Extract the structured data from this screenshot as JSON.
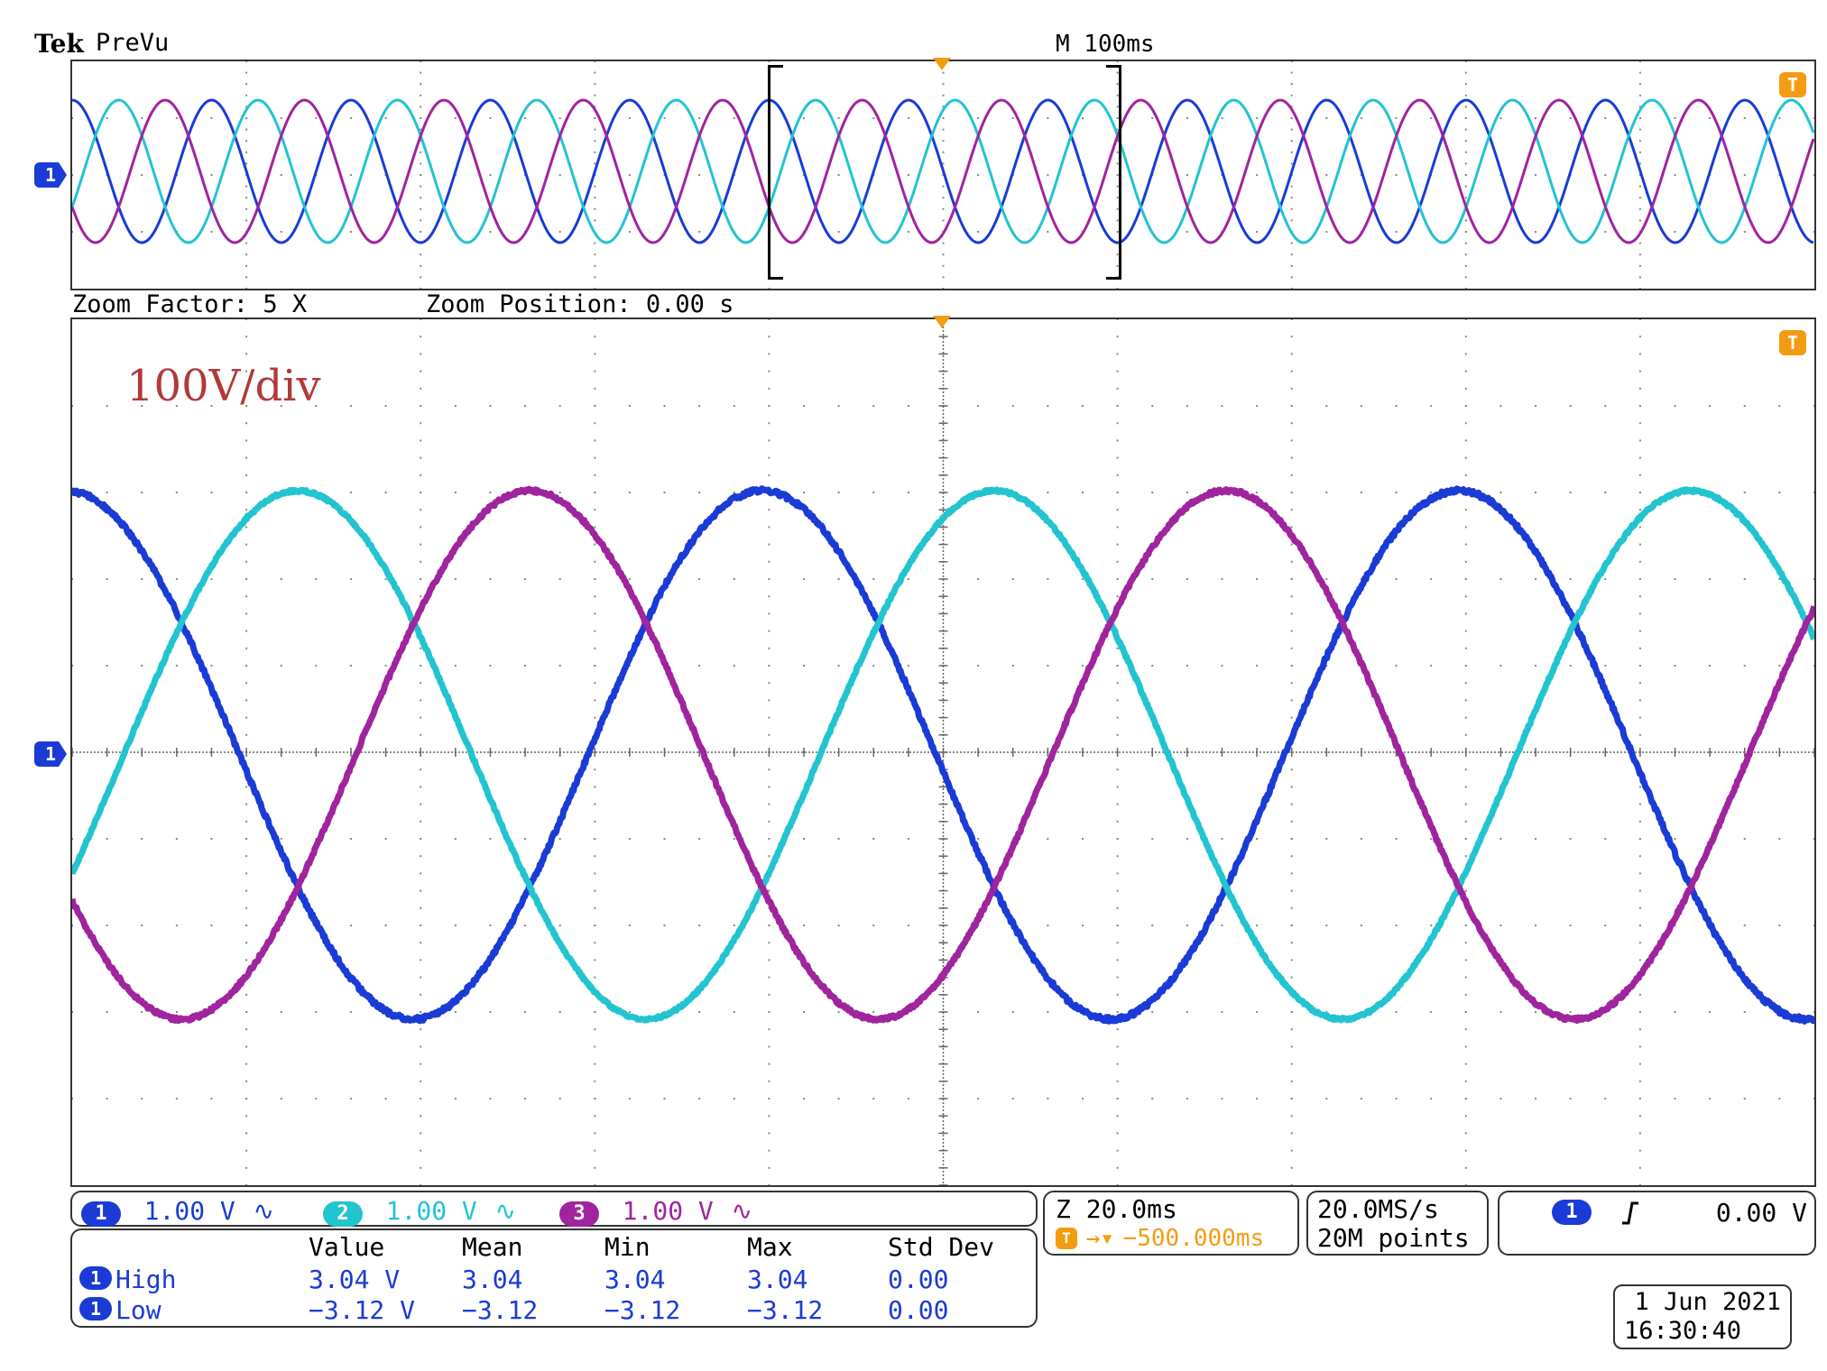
{
  "header": {
    "brand": "Tek",
    "mode": "PreVu",
    "main_timebase": "M 100ms"
  },
  "zoom": {
    "factor_label": "Zoom Factor: 5 X",
    "position_label": "Zoom Position: 0.00 s"
  },
  "annotation": "100V/div",
  "markers": {
    "ch1_ground": "1",
    "trigger_flag": "T"
  },
  "channels": [
    {
      "num": "1",
      "scale": "1.00 V",
      "coupling_icon": "∿",
      "color": "#1a3bd6"
    },
    {
      "num": "2",
      "scale": "1.00 V",
      "coupling_icon": "∿",
      "color": "#22c4d0"
    },
    {
      "num": "3",
      "scale": "1.00 V",
      "coupling_icon": "∿",
      "color": "#a0249e"
    }
  ],
  "timebase": {
    "zoom": "Z 20.0ms",
    "trigger_offset": "−500.000ms",
    "sample_rate": "20.0MS/s",
    "record_length": "20M points"
  },
  "trigger": {
    "source": "1",
    "slope_icon": "rising-edge",
    "level": "0.00 V"
  },
  "measurements": {
    "headers": [
      "Value",
      "Mean",
      "Min",
      "Max",
      "Std Dev"
    ],
    "rows": [
      {
        "source": "1",
        "label": "High",
        "value": "3.04 V",
        "mean": "3.04",
        "min": "3.04",
        "max": "3.04",
        "std": "0.00"
      },
      {
        "source": "1",
        "label": "Low",
        "value": "−3.12 V",
        "mean": "−3.12",
        "min": "−3.12",
        "max": "−3.12",
        "std": "0.00"
      }
    ]
  },
  "datetime": {
    "date": "1 Jun 2021",
    "time": "16:30:40"
  },
  "colors": {
    "ch1": "#1a3bd6",
    "ch2": "#22c4d0",
    "ch3": "#a0249e",
    "trigger": "#f39c12"
  }
}
